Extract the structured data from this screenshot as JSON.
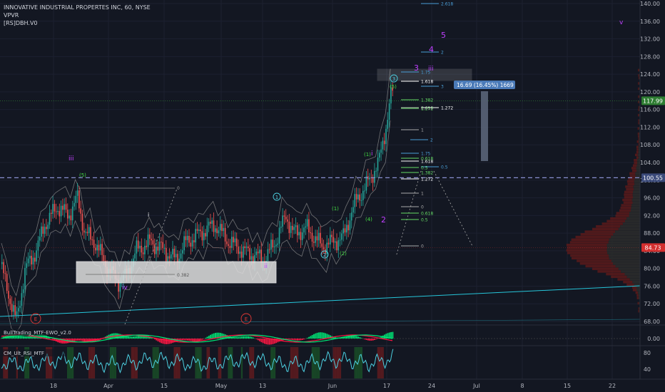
{
  "header": {
    "symbol_line": "INNOVATIVE INDUSTRIAL PROPERTES INC, 60, NYSE",
    "indicator_1": "VPVR",
    "indicator_2": "[RS]DBH.V0"
  },
  "colors": {
    "background": "#131722",
    "up": "#26a69a",
    "down": "#ef5350",
    "wave_purple": "#c040ff",
    "wave_green": "#44dd44",
    "wave_cyan": "#4dd0e1",
    "fib_blue": "#4a9fd8",
    "trendline": "#26c6da",
    "dashed_level": "#8a8fd0"
  },
  "chart_data": {
    "type": "candlestick",
    "y_axis": {
      "ticks": [
        "140.00",
        "136.00",
        "132.00",
        "128.00",
        "124.00",
        "120.00",
        "116.00",
        "112.00",
        "108.00",
        "104.00",
        "100.00",
        "96.00",
        "92.00",
        "88.00",
        "84.00",
        "80.00",
        "76.00",
        "72.00",
        "68.00"
      ],
      "range": [
        65,
        141
      ]
    },
    "x_axis": {
      "ticks": [
        "18",
        "Apr",
        "15",
        "May",
        "13",
        "Jun",
        "17",
        "24",
        "Jul",
        "8",
        "15",
        "22"
      ]
    },
    "price_badges": [
      {
        "label": "117.99",
        "value": 117.99,
        "color": "#2e7d32"
      },
      {
        "label": "100.55",
        "value": 100.55,
        "color": "#3b4a7a"
      },
      {
        "label": "84.73",
        "value": 84.73,
        "color": "#d32f2f"
      }
    ],
    "measure_label": "16.69 (16.45%) 1669",
    "wave_labels": {
      "purple": [
        "iii",
        "iv",
        "ii",
        "3",
        "4",
        "5",
        "iii",
        "v",
        "i",
        "2"
      ],
      "green": [
        "(5)",
        "(1)",
        "(2)",
        "(4)",
        "(5)",
        "(1)"
      ],
      "cyan": [
        "1",
        "2",
        "3"
      ],
      "white": [
        "i",
        "0",
        "0.382"
      ]
    },
    "fib_labels_blue": [
      "2.618",
      "2",
      "1.75",
      "3",
      "2",
      "1.75",
      "0.5",
      "1.382",
      "1.272"
    ],
    "fib_labels_green": [
      "1.382",
      "1.272",
      "0.618",
      "0.5",
      "1.382",
      "0.618",
      "0.5"
    ],
    "fib_labels_white": [
      "1.618",
      "2.618",
      "1.272",
      "1",
      "1.618",
      "1.272",
      "1",
      "0",
      "0"
    ],
    "events": [
      "E",
      "E"
    ],
    "ewo_panel": {
      "label": "BullTrading_MTF-EWO_v2.0",
      "ticks": [
        "0.00"
      ]
    },
    "rsi_panel": {
      "label": "CM_Ult_RSI_MTF",
      "ticks": [
        "80",
        "40"
      ]
    }
  }
}
